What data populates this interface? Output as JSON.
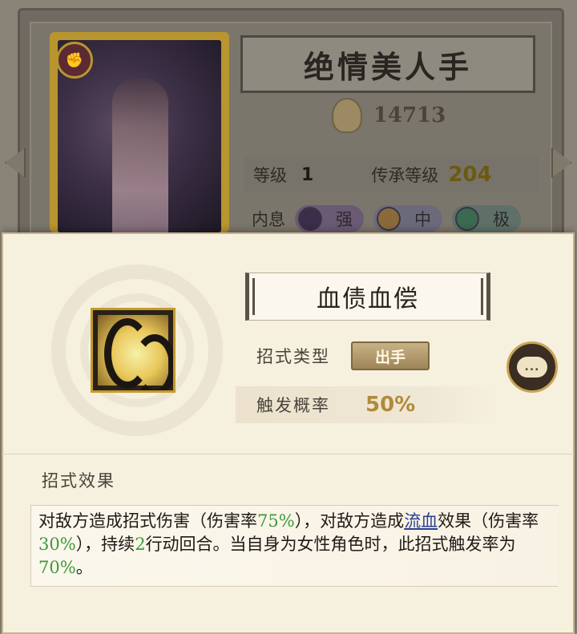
{
  "background": {
    "character_name": "绝情美人手",
    "power": "14713",
    "level_label": "等级",
    "level_value": "1",
    "inherit_label": "传承等级",
    "inherit_value": "204",
    "inner_label": "内息",
    "inner_pills": [
      "强",
      "中",
      "极"
    ]
  },
  "skill": {
    "name": "血债血偿",
    "type_label": "招式类型",
    "type_value": "出手",
    "rate_label": "触发概率",
    "rate_value": "50%",
    "chat_icon_text": "...",
    "effect_heading": "招式效果",
    "effect": {
      "t1": "对敌方造成招式伤害（伤害率",
      "v1": "75%",
      "t2": "），对敌方造成",
      "link": "流血",
      "t3": "效果（伤害率",
      "v2": "30%",
      "t4": "），持续",
      "v3": "2",
      "t5": "行动回合。当自身为女性角色时，此招式触发率为",
      "v4": "70%",
      "t6": "。"
    }
  },
  "colors": {
    "highlight_green": "#3e9a3a",
    "link_blue": "#2a3e8e",
    "gold_frame": "#c49a2c"
  }
}
